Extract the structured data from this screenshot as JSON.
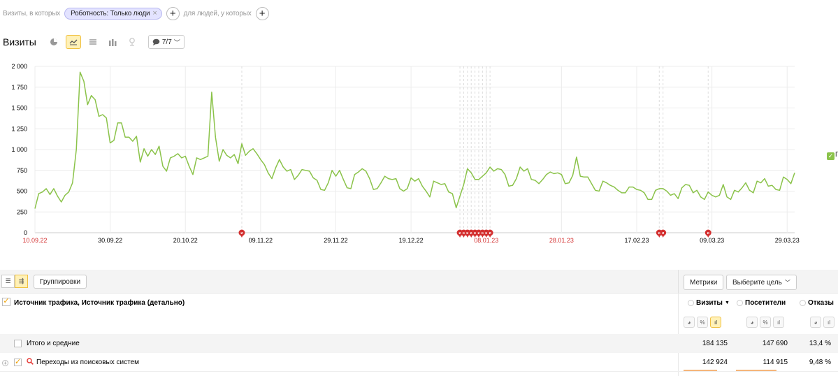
{
  "filters": {
    "visits_label": "Визиты, в которых",
    "segment_pill": "Роботность: Только люди",
    "people_label": "для людей, у которых",
    "add_symbol": "+"
  },
  "header": {
    "title": "Визиты",
    "annotations_count": "7/7"
  },
  "chart_data": {
    "type": "line",
    "ylim": [
      0,
      2000
    ],
    "yticks": [
      "0",
      "250",
      "500",
      "750",
      "1 000",
      "1 250",
      "1 500",
      "1 750",
      "2 000"
    ],
    "x_start": "10.09.22",
    "x_end": "29.03.23",
    "xticks": [
      {
        "label": "10.09.22",
        "day": 0,
        "red": true
      },
      {
        "label": "30.09.22",
        "day": 20,
        "red": false
      },
      {
        "label": "20.10.22",
        "day": 40,
        "red": false
      },
      {
        "label": "09.11.22",
        "day": 60,
        "red": false
      },
      {
        "label": "29.11.22",
        "day": 80,
        "red": false
      },
      {
        "label": "19.12.22",
        "day": 100,
        "red": false
      },
      {
        "label": "08.01.23",
        "day": 120,
        "red": true
      },
      {
        "label": "28.01.23",
        "day": 140,
        "red": true
      },
      {
        "label": "17.02.23",
        "day": 160,
        "red": false
      },
      {
        "label": "09.03.23",
        "day": 180,
        "red": false
      },
      {
        "label": "29.03.23",
        "day": 200,
        "red": false
      }
    ],
    "annotation_days": [
      55,
      113,
      114,
      115,
      116,
      117,
      118,
      119,
      120,
      121,
      166,
      167,
      179
    ],
    "series": [
      {
        "color": "#8bc34a",
        "values": [
          290,
          470,
          490,
          530,
          460,
          530,
          440,
          370,
          450,
          490,
          600,
          1000,
          1930,
          1820,
          1540,
          1650,
          1600,
          1400,
          1420,
          1380,
          1080,
          1110,
          1320,
          1320,
          1150,
          1150,
          1100,
          1160,
          850,
          1010,
          920,
          1000,
          940,
          1040,
          800,
          740,
          900,
          920,
          950,
          900,
          920,
          800,
          700,
          900,
          880,
          900,
          920,
          1690,
          1150,
          860,
          1000,
          930,
          900,
          940,
          830,
          1070,
          930,
          980,
          1010,
          950,
          880,
          820,
          720,
          650,
          780,
          880,
          790,
          740,
          760,
          640,
          690,
          760,
          750,
          740,
          660,
          630,
          520,
          510,
          600,
          750,
          680,
          750,
          640,
          540,
          530,
          700,
          730,
          770,
          740,
          650,
          520,
          530,
          600,
          680,
          650,
          640,
          650,
          530,
          500,
          530,
          660,
          620,
          650,
          560,
          500,
          430,
          620,
          600,
          580,
          590,
          490,
          470,
          300,
          440,
          580,
          770,
          720,
          640,
          640,
          680,
          720,
          790,
          740,
          770,
          760,
          700,
          560,
          570,
          650,
          790,
          740,
          770,
          640,
          630,
          590,
          640,
          700,
          730,
          710,
          720,
          700,
          590,
          600,
          690,
          910,
          680,
          670,
          670,
          590,
          510,
          500,
          620,
          600,
          570,
          550,
          510,
          480,
          480,
          550,
          550,
          520,
          510,
          480,
          400,
          400,
          510,
          530,
          530,
          500,
          450,
          470,
          410,
          540,
          580,
          570,
          480,
          510,
          430,
          400,
          490,
          450,
          430,
          450,
          580,
          430,
          400,
          510,
          490,
          540,
          600,
          510,
          480,
          620,
          600,
          650,
          560,
          570,
          520,
          510,
          670,
          640,
          590,
          720
        ]
      }
    ]
  },
  "legend": {
    "label": "П"
  },
  "table": {
    "groupings_label": "Группировки",
    "metrics_label": "Метрики",
    "goal_label": "Выберите цель",
    "dimension_title": "Источник трафика, Источник трафика (детально)",
    "metrics": [
      {
        "label": "Визиты",
        "sorted": "▼"
      },
      {
        "label": "Посетители"
      },
      {
        "label": "Отказы"
      }
    ],
    "mini": {
      "pie": "◕",
      "pct": "%",
      "bars": "ıl"
    },
    "total_row": {
      "label": "Итого и средние",
      "visits": "184 135",
      "visitors": "147 690",
      "bounces": "13,4 %"
    },
    "rows": [
      {
        "label": "Переходы из поисковых систем",
        "visits": "142 924",
        "visitors": "114 915",
        "bounces": "9,48 %",
        "visits_share": 0.776,
        "visitors_share": 0.778
      }
    ]
  }
}
